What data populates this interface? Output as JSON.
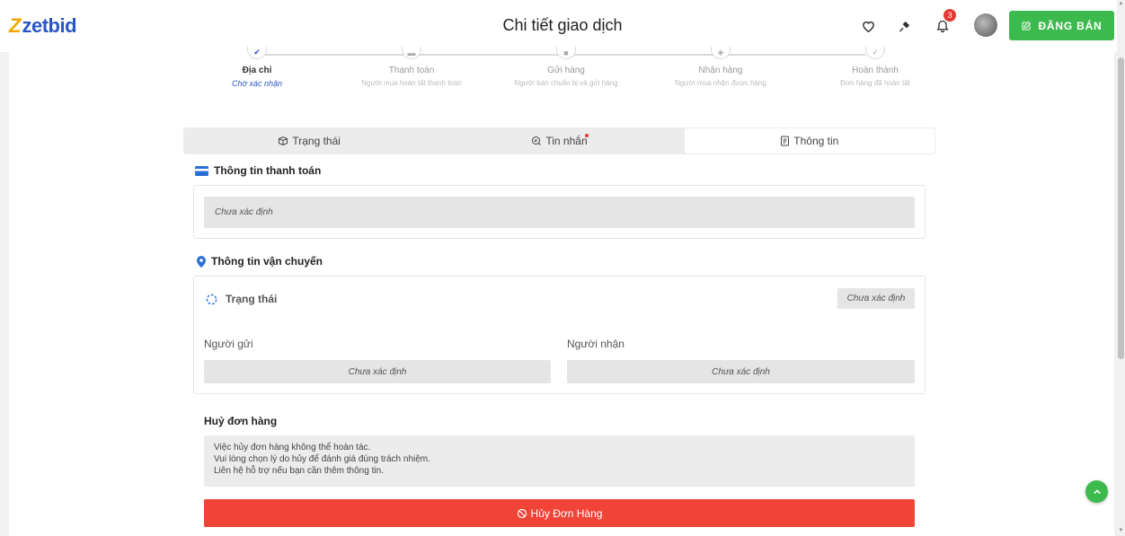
{
  "header": {
    "logo_text": "zetbid",
    "title": "Chi tiết giao dịch",
    "notification_count": "3",
    "sell_label": "ĐĂNG BÁN"
  },
  "stepper": {
    "steps": [
      {
        "label": "Địa chỉ",
        "sub": "Chờ xác nhận",
        "icon": "truck-icon"
      },
      {
        "label": "Thanh toán",
        "sub": "Người mua hoàn tất thanh toán",
        "icon": "card-icon"
      },
      {
        "label": "Gửi hàng",
        "sub": "Người bán chuẩn bị và gửi hàng",
        "icon": "truck-icon"
      },
      {
        "label": "Nhận hàng",
        "sub": "Người mua nhận được hàng",
        "icon": "package-icon"
      },
      {
        "label": "Hoàn thành",
        "sub": "Đơn hàng đã hoàn tất",
        "icon": "check-icon"
      }
    ]
  },
  "tabs": [
    {
      "label": "Trạng thái"
    },
    {
      "label": "Tin nhắn"
    },
    {
      "label": "Thông tin"
    }
  ],
  "payment": {
    "title": "Thông tin thanh toán",
    "value": "Chưa xác định"
  },
  "shipping": {
    "title": "Thông tin vận chuyển",
    "status_label": "Trạng thái",
    "status_value": "Chưa xác định",
    "sender_label": "Người gửi",
    "sender_value": "Chưa xác định",
    "receiver_label": "Người nhận",
    "receiver_value": "Chưa xác định"
  },
  "cancel": {
    "title": "Huỷ đơn hàng",
    "line1": "Việc hủy đơn hàng không thể hoàn tác.",
    "line2": "Vui lòng chọn lý do hủy để đánh giá đúng trách nhiệm.",
    "line3": "Liên hệ hỗ trợ nếu bạn cần thêm thông tin.",
    "button_label": "Hủy Đơn Hàng"
  },
  "colors": {
    "brand_blue": "#2a55c4",
    "brand_green": "#3dba4e",
    "danger": "#f04438"
  }
}
